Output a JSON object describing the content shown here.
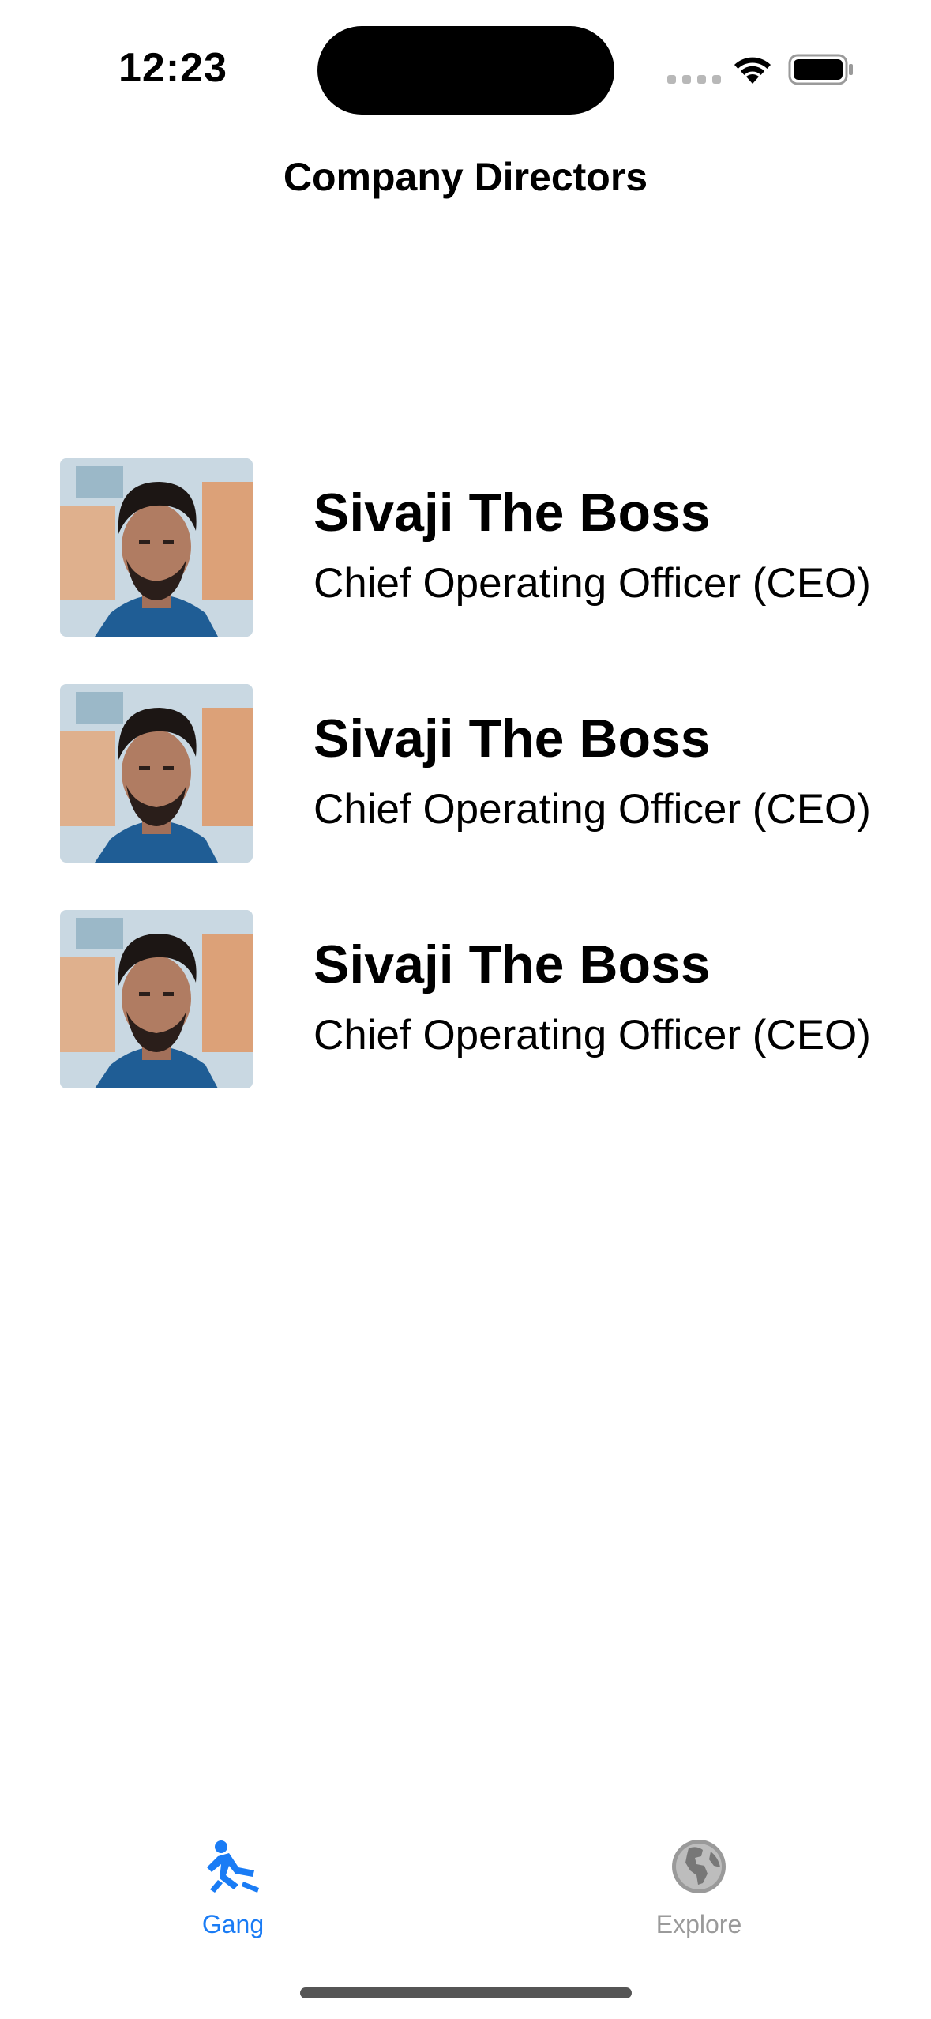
{
  "status_bar": {
    "time": "12:23"
  },
  "nav": {
    "title": "Company Directors"
  },
  "directors": [
    {
      "name": "Sivaji The Boss",
      "role": "Chief Operating Officer (CEO)"
    },
    {
      "name": "Sivaji The Boss",
      "role": "Chief Operating Officer (CEO)"
    },
    {
      "name": "Sivaji The Boss",
      "role": "Chief Operating Officer (CEO)"
    }
  ],
  "tab_bar": {
    "tabs": [
      {
        "label": "Gang",
        "icon": "figure-fall-icon",
        "selected": true
      },
      {
        "label": "Explore",
        "icon": "globe-icon",
        "selected": false
      }
    ]
  },
  "colors": {
    "accent": "#1A7CF5",
    "inactive": "#9A9A9A",
    "text": "#000000"
  }
}
